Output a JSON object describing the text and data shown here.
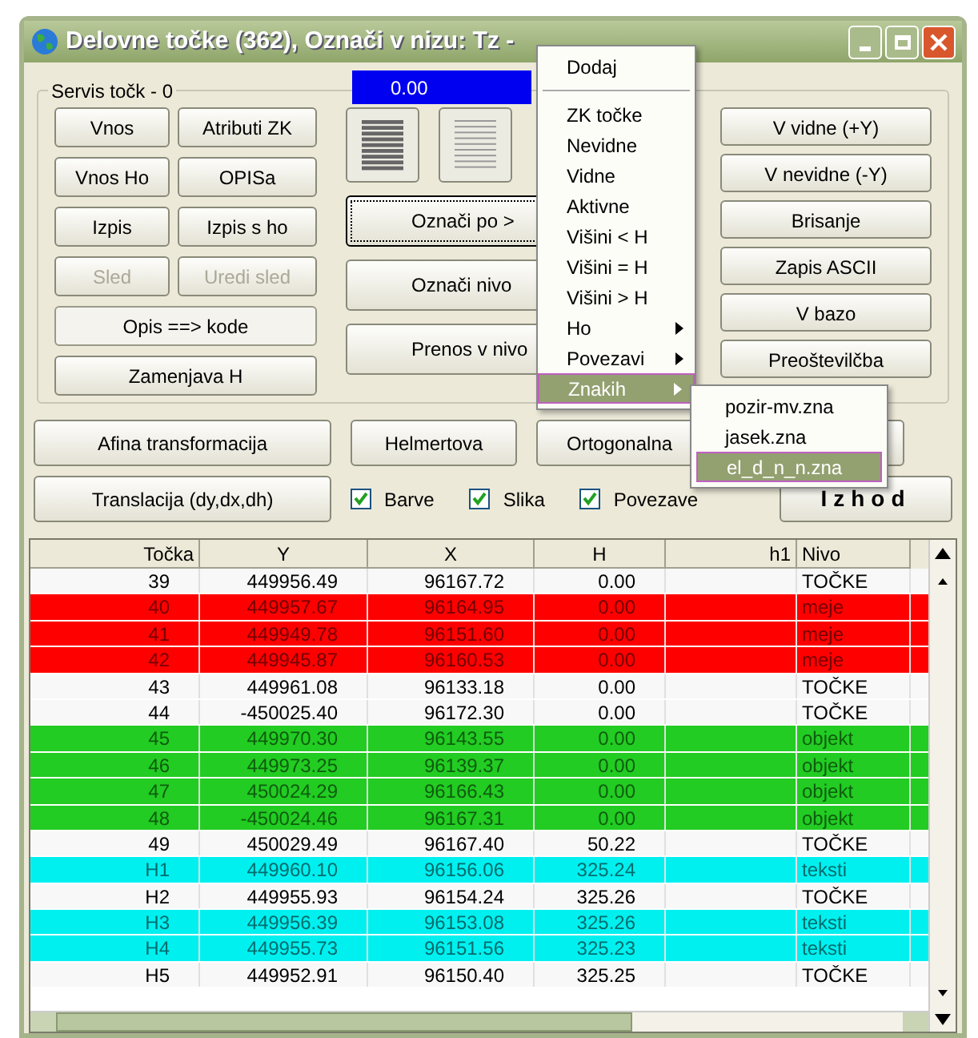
{
  "window": {
    "title": "Delovne točke (362),  Označi v nizu: Tz -"
  },
  "group": {
    "title": "Servis točk - 0"
  },
  "value_field": {
    "value": "0.00"
  },
  "left_buttons": [
    {
      "label": "Vnos",
      "disabled": false
    },
    {
      "label": "Atributi ZK",
      "disabled": false
    },
    {
      "label": "Vnos Ho",
      "disabled": false
    },
    {
      "label": "OPISa",
      "disabled": false
    },
    {
      "label": "Izpis",
      "disabled": false
    },
    {
      "label": "Izpis s ho",
      "disabled": false
    },
    {
      "label": "Sled",
      "disabled": true
    },
    {
      "label": "Uredi sled",
      "disabled": true
    }
  ],
  "wide_buttons": [
    {
      "label": "Opis ==> kode",
      "pressed": true
    },
    {
      "label": "Zamenjava H",
      "pressed": false
    }
  ],
  "middle_buttons": [
    {
      "label": "Označi po >",
      "focused": true
    },
    {
      "label": "Označi nivo",
      "focused": false
    },
    {
      "label": "Prenos v nivo",
      "focused": false
    }
  ],
  "right_buttons": [
    "V vidne (+Y)",
    "V nevidne (-Y)",
    "Brisanje",
    "Zapis ASCII",
    "V bazo",
    "Preoštevilčba"
  ],
  "transform_buttons": [
    "Afina transformacija",
    "Helmertova",
    "Ortogonalna"
  ],
  "translation_button": "Translacija (dy,dx,dh)",
  "checkboxes": [
    {
      "label": "Barve",
      "checked": true
    },
    {
      "label": "Slika",
      "checked": true
    },
    {
      "label": "Povezave",
      "checked": true
    }
  ],
  "exit_button": "Izhod",
  "menu": {
    "items": [
      {
        "kind": "item",
        "label": "Dodaj",
        "submenu": false,
        "selected": false
      },
      {
        "kind": "separator"
      },
      {
        "kind": "item",
        "label": "ZK točke",
        "submenu": false,
        "selected": false
      },
      {
        "kind": "item",
        "label": "Nevidne",
        "submenu": false,
        "selected": false
      },
      {
        "kind": "item",
        "label": "Vidne",
        "submenu": false,
        "selected": false
      },
      {
        "kind": "item",
        "label": "Aktivne",
        "submenu": false,
        "selected": false
      },
      {
        "kind": "item",
        "label": "Višini < H",
        "submenu": false,
        "selected": false
      },
      {
        "kind": "item",
        "label": "Višini = H",
        "submenu": false,
        "selected": false
      },
      {
        "kind": "item",
        "label": "Višini > H",
        "submenu": false,
        "selected": false
      },
      {
        "kind": "item",
        "label": "Ho",
        "submenu": true,
        "selected": false
      },
      {
        "kind": "item",
        "label": "Povezavi",
        "submenu": true,
        "selected": false
      },
      {
        "kind": "item",
        "label": "Znakih",
        "submenu": true,
        "selected": true
      }
    ],
    "submenu": [
      {
        "label": "pozir-mv.zna",
        "selected": false
      },
      {
        "label": "jasek.zna",
        "selected": false
      },
      {
        "label": "el_d_n_n.zna",
        "selected": true
      }
    ]
  },
  "table": {
    "columns": [
      "Točka",
      "Y",
      "X",
      "H",
      "h1",
      "Nivo"
    ],
    "rows": [
      {
        "cells": [
          "39",
          "449956.49",
          "96167.72",
          "0.00",
          "",
          "TOČKE"
        ],
        "color": "#f8f8f8"
      },
      {
        "cells": [
          "40",
          "449957.67",
          "96164.95",
          "0.00",
          "",
          "meje"
        ],
        "color": "#ff0000"
      },
      {
        "cells": [
          "41",
          "449949.78",
          "96151.60",
          "0.00",
          "",
          "meje"
        ],
        "color": "#ff0000"
      },
      {
        "cells": [
          "42",
          "449945.87",
          "96160.53",
          "0.00",
          "",
          "meje"
        ],
        "color": "#ff0000"
      },
      {
        "cells": [
          "43",
          "449961.08",
          "96133.18",
          "0.00",
          "",
          "TOČKE"
        ],
        "color": "#f8f8f8"
      },
      {
        "cells": [
          "44",
          "-450025.40",
          "96172.30",
          "0.00",
          "",
          "TOČKE"
        ],
        "color": "#f8f8f8"
      },
      {
        "cells": [
          "45",
          "449970.30",
          "96143.55",
          "0.00",
          "",
          "objekt"
        ],
        "color": "#22cc22"
      },
      {
        "cells": [
          "46",
          "449973.25",
          "96139.37",
          "0.00",
          "",
          "objekt"
        ],
        "color": "#22cc22"
      },
      {
        "cells": [
          "47",
          "450024.29",
          "96166.43",
          "0.00",
          "",
          "objekt"
        ],
        "color": "#22cc22"
      },
      {
        "cells": [
          "48",
          "-450024.46",
          "96167.31",
          "0.00",
          "",
          "objekt"
        ],
        "color": "#22cc22"
      },
      {
        "cells": [
          "49",
          "450029.49",
          "96167.40",
          "50.22",
          "",
          "TOČKE"
        ],
        "color": "#f8f8f8"
      },
      {
        "cells": [
          "H1",
          "449960.10",
          "96156.06",
          "325.24",
          "",
          "teksti"
        ],
        "color": "#00f0f0"
      },
      {
        "cells": [
          "H2",
          "449955.93",
          "96154.24",
          "325.26",
          "",
          "TOČKE"
        ],
        "color": "#f8f8f8"
      },
      {
        "cells": [
          "H3",
          "449956.39",
          "96153.08",
          "325.26",
          "",
          "teksti"
        ],
        "color": "#00f0f0"
      },
      {
        "cells": [
          "H4",
          "449955.73",
          "96151.56",
          "325.23",
          "",
          "teksti"
        ],
        "color": "#00f0f0"
      },
      {
        "cells": [
          "H5",
          "449952.91",
          "96150.40",
          "325.25",
          "",
          "TOČKE"
        ],
        "color": "#f8f8f8"
      }
    ]
  }
}
